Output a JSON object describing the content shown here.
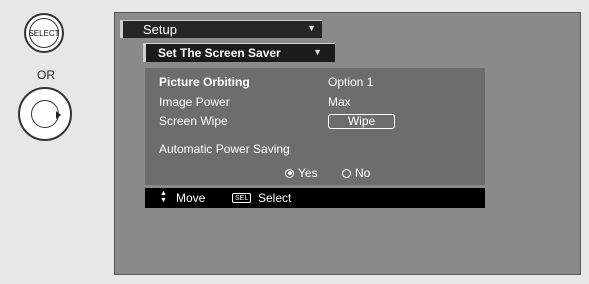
{
  "remote": {
    "select_label": "SELECT",
    "or_label": "OR"
  },
  "menu": {
    "setup_label": "Setup",
    "submenu_label": "Set The Screen Saver",
    "items": [
      {
        "label": "Picture Orbiting",
        "value": "Option 1"
      },
      {
        "label": "Image Power",
        "value": "Max"
      },
      {
        "label": "Screen Wipe",
        "button": "Wipe"
      }
    ],
    "power_saving": {
      "label": "Automatic Power Saving",
      "options": [
        "Yes",
        "No"
      ],
      "selected": "Yes"
    }
  },
  "status": {
    "move_label": "Move",
    "sel_key": "SEL",
    "select_label": "Select"
  },
  "colors": {
    "tv_background": "#8a8a8a",
    "panel_background": "#6d6d6d",
    "bar_background": "#1b1b1b",
    "status_background": "#000000"
  }
}
